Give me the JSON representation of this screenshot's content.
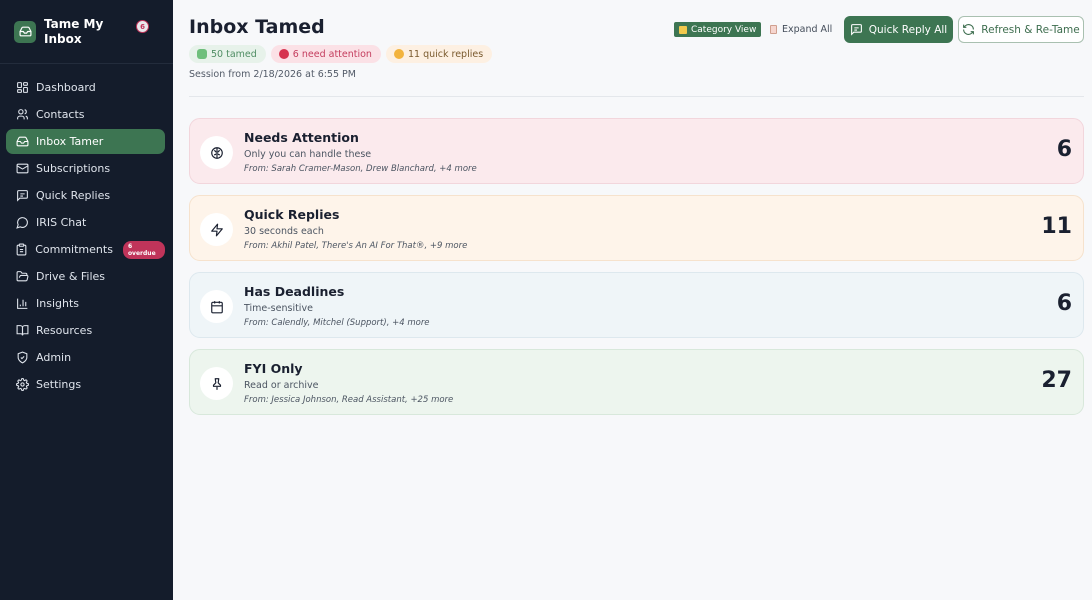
{
  "app": {
    "name": "Tame My Inbox",
    "notification_count": "6"
  },
  "sidebar": {
    "items": [
      {
        "label": "Dashboard",
        "icon": "dashboard-icon"
      },
      {
        "label": "Contacts",
        "icon": "users-icon"
      },
      {
        "label": "Inbox Tamer",
        "icon": "inbox-icon",
        "active": true
      },
      {
        "label": "Subscriptions",
        "icon": "mail-icon"
      },
      {
        "label": "Quick Replies",
        "icon": "message-square-icon"
      },
      {
        "label": "IRIS Chat",
        "icon": "chat-icon"
      },
      {
        "label": "Commitments",
        "icon": "clipboard-icon",
        "badge": "6 overdue"
      },
      {
        "label": "Drive & Files",
        "icon": "folder-icon"
      },
      {
        "label": "Insights",
        "icon": "bar-chart-icon"
      },
      {
        "label": "Resources",
        "icon": "book-icon"
      },
      {
        "label": "Admin",
        "icon": "shield-icon"
      },
      {
        "label": "Settings",
        "icon": "gear-icon"
      }
    ]
  },
  "header": {
    "title": "Inbox Tamed",
    "chips": {
      "tamed": "50 tamed",
      "attention": "6 need attention",
      "quick": "11 quick replies"
    },
    "session": "Session from 2/18/2026 at 6:55 PM"
  },
  "toolbar": {
    "category_view": "Category View",
    "expand_all": "Expand All",
    "quick_reply_all": "Quick Reply All",
    "refresh": "Refresh & Re-Tame"
  },
  "categories": [
    {
      "title": "Needs Attention",
      "subtitle": "Only you can handle these",
      "from": "From: Sarah Cramer-Mason, Drew Blanchard, +4 more",
      "count": "6",
      "icon": "brain-icon"
    },
    {
      "title": "Quick Replies",
      "subtitle": "30 seconds each",
      "from": "From: Akhil Patel, There's An AI For That®, +9 more",
      "count": "11",
      "icon": "lightning-icon"
    },
    {
      "title": "Has Deadlines",
      "subtitle": "Time-sensitive",
      "from": "From: Calendly, Mitchel (Support), +4 more",
      "count": "6",
      "icon": "calendar-icon"
    },
    {
      "title": "FYI Only",
      "subtitle": "Read or archive",
      "from": "From: Jessica Johnson, Read Assistant, +25 more",
      "count": "27",
      "icon": "pin-icon"
    }
  ],
  "colors": {
    "sidebar_bg": "#141c2b",
    "accent_green": "#3d7552",
    "attention_pink": "#c0345a"
  }
}
